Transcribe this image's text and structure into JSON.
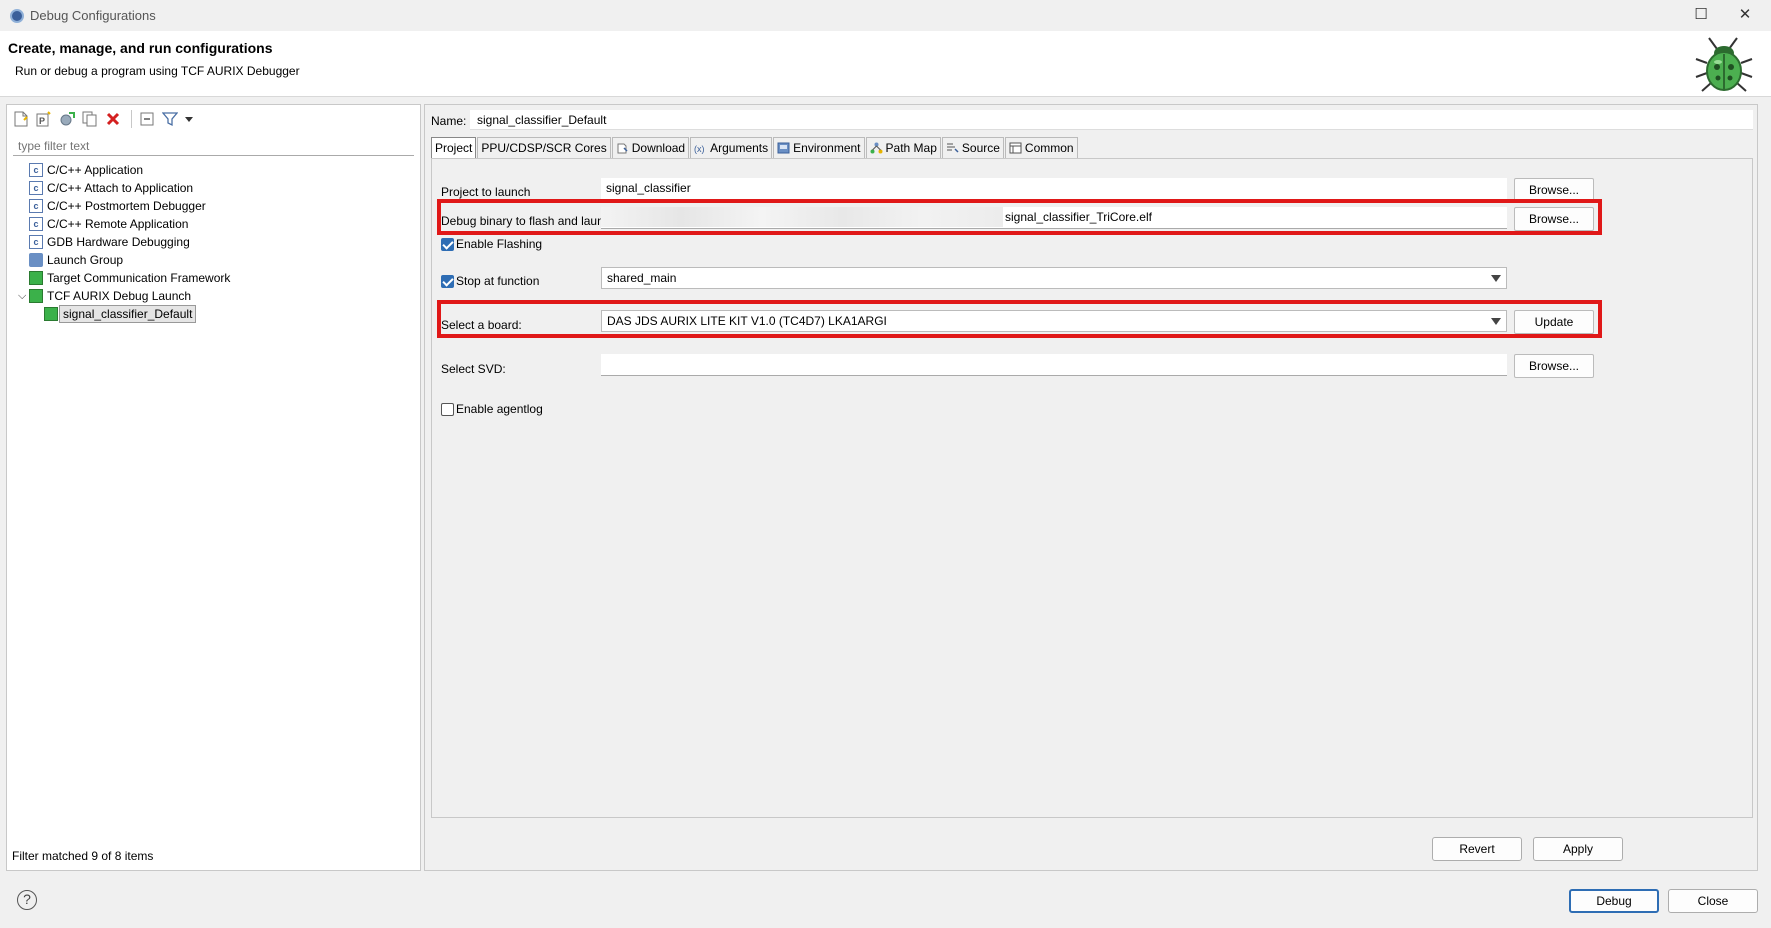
{
  "window": {
    "title": "Debug Configurations",
    "maximize_glyph": "☐",
    "close_glyph": "✕"
  },
  "header": {
    "title": "Create, manage, and run configurations",
    "subtitle": "Run or debug a program using TCF AURIX Debugger"
  },
  "left": {
    "filter_placeholder": "type filter text",
    "tree": [
      {
        "label": "C/C++ Application",
        "icon": "c-icon"
      },
      {
        "label": "C/C++ Attach to Application",
        "icon": "c-icon"
      },
      {
        "label": "C/C++ Postmortem Debugger",
        "icon": "c-icon"
      },
      {
        "label": "C/C++ Remote Application",
        "icon": "c-icon"
      },
      {
        "label": "GDB Hardware Debugging",
        "icon": "c-icon"
      },
      {
        "label": "Launch Group",
        "icon": "launch-group-icon"
      },
      {
        "label": "Target Communication Framework",
        "icon": "tcf-icon"
      },
      {
        "label": "TCF AURIX Debug Launch",
        "icon": "tcf-icon",
        "expanded": true
      },
      {
        "label": "signal_classifier_Default",
        "icon": "tcf-icon",
        "selected": true
      }
    ],
    "expand_glyph": "⌵",
    "filter_status": "Filter matched 9 of 8 items"
  },
  "right": {
    "name_label": "Name:",
    "name_value": "signal_classifier_Default",
    "tabs": [
      {
        "label": "Project",
        "active": true
      },
      {
        "label": "PPU/CDSP/SCR Cores"
      },
      {
        "label": "Download"
      },
      {
        "label": "Arguments"
      },
      {
        "label": "Environment"
      },
      {
        "label": "Path Map"
      },
      {
        "label": "Source"
      },
      {
        "label": "Common"
      }
    ],
    "project_label": "Project to launch",
    "project_value": "signal_classifier",
    "browse_label": "Browse...",
    "binary_label": "Debug binary to flash and launch",
    "binary_value": "signal_classifier_TriCore.elf",
    "enable_flashing_label": "Enable Flashing",
    "stop_at_function_label": "Stop at function",
    "stop_at_function_value": "shared_main",
    "board_label": "Select a board:",
    "board_value": "DAS JDS AURIX LITE KIT V1.0 (TC4D7) LKA1ARGI",
    "update_label": "Update",
    "svd_label": "Select SVD:",
    "svd_value": "",
    "agentlog_label": "Enable agentlog",
    "revert_label": "Revert",
    "apply_label": "Apply"
  },
  "footer": {
    "help_glyph": "?",
    "debug_label": "Debug",
    "close_label": "Close"
  },
  "colors": {
    "highlight": "#e01818",
    "accent": "#2e6db4"
  }
}
